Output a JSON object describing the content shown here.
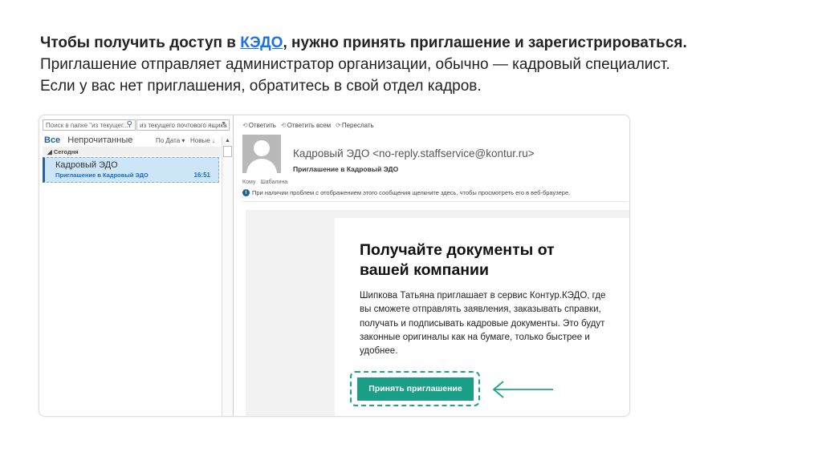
{
  "intro": {
    "line1_before": "Чтобы получить доступ в ",
    "line1_link": "КЭДО",
    "line1_after": ", нужно принять приглашение и зарегистрироваться.",
    "line2": "Приглашение отправляет администратор организации, обычно — кадровый специалист.",
    "line3": "Если у вас нет приглашения, обратитесь в свой отдел кадров."
  },
  "mail_list": {
    "search_placeholder": "Поиск в папке \"из текущег...",
    "scope": "из текущего почтового ящика",
    "tab_all": "Все",
    "tab_unread": "Непрочитанные",
    "sort": "По Дата",
    "order": "Новые",
    "group": "Сегодня",
    "items": [
      {
        "from": "Кадровый ЭДО",
        "subject": "Приглашение в Кадровый ЭДО",
        "time": "16:51"
      }
    ]
  },
  "reading": {
    "reply": "Ответить",
    "reply_all": "Ответить всем",
    "forward": "Переслать",
    "sender": "Кадровый ЭДО <no-reply.staffservice@kontur.ru>",
    "subject": "Приглашение в Кадровый ЭДО",
    "to_label": "Кому",
    "to_value": "Шабалина",
    "info": "При наличии проблем с отображением этого сообщения щелкните здесь, чтобы просмотреть его в веб-браузере."
  },
  "email_body": {
    "title": "Получайте документы от вашей компании",
    "text": "Шипкова Татьяна приглашает в сервис Контур.КЭДО, где вы сможете отправлять заявления, заказывать справки, получать и подписывать кадровые документы. Это будут законные оригиналы как на бумаге, только быстрее и удобнее.",
    "button": "Принять приглашение"
  },
  "colors": {
    "accent": "#1a9f86",
    "link": "#1a73e8",
    "selected": "#cde6f7"
  }
}
